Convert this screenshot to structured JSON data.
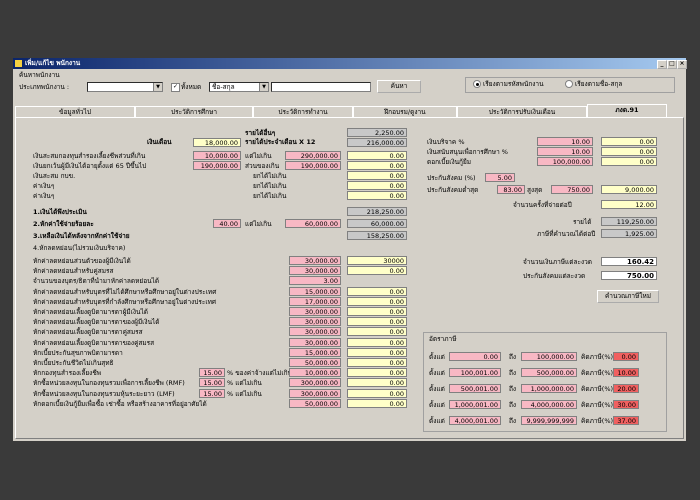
{
  "window": {
    "title": "เพิ่ม/แก้ไข พนักงาน",
    "min": "_",
    "max": "□",
    "close": "×"
  },
  "search": {
    "group_label": "ค้นหาพนักงาน",
    "type_label": "ประเภทพนักงาน :",
    "type_value": "",
    "all_label": "ทั้งหมด",
    "field_value": "ชื่อ-สกุล",
    "text_value": "",
    "search_button": "ค้นหา",
    "radio_by_id": "เรียงตามรหัสพนักงาน",
    "radio_by_name": "เรียงตามชื่อ-สกุล"
  },
  "tabs": [
    "ข้อมูลทั่วไป",
    "ประวัติการศึกษา",
    "ประวัติการทำงาน",
    "ฝึกอบรม/ดูงาน",
    "ประวัติการปรับเงินเดือน",
    "ภงด.91"
  ],
  "left": {
    "salary_label": "เงินเดือน",
    "salary": "18,000.00",
    "income_label": "รายได้อื่นๆ",
    "income": "2,250.00",
    "annual_label": "รายได้ประจำเดือน X 12",
    "annual": "216,000.00",
    "r1": "เงินสะสมกองทุนสำรองเลี้ยงชีพส่วนที่เกิน",
    "r1v": "10,000.00",
    "r1n": "แต่ไม่เกิน",
    "r1m": "290,000.00",
    "r1x": "0.00",
    "r2": "เงินยกเว้นผู้มีเงินได้อายุตั้งแต่ 65 ปีขึ้นไป",
    "r2v": "190,000.00",
    "r2n": "ส่วนของเกิน",
    "r2m": "190,000.00",
    "r2x": "0.00",
    "r3": "เงินสะสม กบข.",
    "r3n": "ยกได้ไม่เกิน",
    "r3x": "0.00",
    "r4": "ค่าเงินๆ",
    "r4n": "ยกได้ไม่เกิน",
    "r4x": "0.00",
    "r5": "ค่าเงินๆ",
    "r5n": "ยกได้ไม่เกิน",
    "r5x": "0.00",
    "s1": "1.เงินได้พึงประเมิน",
    "s1x": "218,250.00",
    "s2": "2.หักค่าใช้จ่ายร้อยละ",
    "s2v": "40.00",
    "s2n": "แต่ไม่เกิน",
    "s2m": "60,000.00",
    "s2x": "60,000.00",
    "s3": "3.เหลือเงินได้หลังจากหักค่าใช้จ่าย",
    "s3x": "158,250.00",
    "s4": "4.หักลดหย่อน(ไม่รวมเงินบริจาค)"
  },
  "deductions": [
    {
      "label": "หักค่าลดหย่อนส่วนตัวของผู้มีเงินได้",
      "max": "30,000.00",
      "val": "30000"
    },
    {
      "label": "หักค่าลดหย่อนสำหรับคู่สมรส",
      "max": "30,000.00",
      "val": "0.00"
    },
    {
      "label": "จำนวนของบุตร/ธิดาที่นำมาหักค่าลดหย่อนได้",
      "max": "3.00",
      "val": ""
    },
    {
      "label": "หักค่าลดหย่อนสำหรับบุตรที่ไม่ได้ศึกษาหรือศึกษาอยู่ในต่างประเทศ",
      "max": "15,000.00",
      "val": "0.00"
    },
    {
      "label": "หักค่าลดหย่อนสำหรับบุตรที่กำลังศึกษาหรือศึกษาอยู่ในต่างประเทศ",
      "max": "17,000.00",
      "val": "0.00"
    },
    {
      "label": "หักค่าลดหย่อนเลี้ยงดูบิดามารดาผู้มีเงินได้",
      "max": "30,000.00",
      "val": "0.00"
    },
    {
      "label": "หักค่าลดหย่อนเลี้ยงดูบิดามารดาของผู้มีเงินได้",
      "max": "30,000.00",
      "val": "0.00"
    },
    {
      "label": "หักค่าลดหย่อนเลี้ยงดูบิดามารดาคู่สมรส",
      "max": "30,000.00",
      "val": "0.00"
    },
    {
      "label": "หักค่าลดหย่อนเลี้ยงดูบิดามารดาของคู่สมรส",
      "max": "30,000.00",
      "val": "0.00"
    },
    {
      "label": "หักเบี้ยประกันสุขภาพบิดามารดา",
      "max": "15,000.00",
      "val": "0.00"
    },
    {
      "label": "หักเบี้ยประกันชีวิตไม่เกินสุทธิ",
      "max": "50,000.00",
      "val": "0.00"
    },
    {
      "label": "หักกองทุนสำรองเลี้ยงชีพ",
      "pct": "15.00",
      "note": "% ของค่าจ้างแต่ไม่เกิน",
      "max": "10,000.00",
      "val": "0.00"
    },
    {
      "label": "หักซื้อหน่วยลงทุนในกองทุนรวมเพื่อการเลี้ยงชีพ (RMF)",
      "pct": "15.00",
      "note": "% แต่ไม่เกิน",
      "max": "300,000.00",
      "val": "0.00"
    },
    {
      "label": "หักซื้อหน่วยลงทุนในกองทุนรวมหุ้นระยะยาว (LMF)",
      "pct": "15.00",
      "note": "% แต่ไม่เกิน",
      "max": "300,000.00",
      "val": "0.00"
    },
    {
      "label": "หักดอกเบี้ยเงินกู้ยืมเพื่อซื้อ เช่าซื้อ หรือสร้างอาคารที่อยู่อาศัยได้",
      "max": "50,000.00",
      "val": "0.00"
    }
  ],
  "right": {
    "d1": "เงินบริจาค %",
    "d1v": "10.00",
    "d1x": "0.00",
    "d2": "เงินสนับสนุนเพื่อการศึกษา %",
    "d2v": "10.00",
    "d2x": "0.00",
    "d3": "ดอกเบี้ยเงินกู้ยืม",
    "d3v": "100,000.00",
    "d3x": "0.00",
    "d4": "ประกันสังคม (%)",
    "d4v": "5.00",
    "d5": "ประกันสังคมต่ำสุด",
    "d5v": "83.00",
    "d5n": "สูงสุด",
    "d5m": "750.00",
    "d5x": "9,000.00",
    "d6": "จำนวนครั้งที่จ่ายต่อปี",
    "d6x": "12.00",
    "d7": "รายได้",
    "d7x": "119,250.00",
    "d8": "ภาษีที่คำนวณได้ต่อปี",
    "d8x": "1,925.00",
    "d9": "จำนวนเงินภาษีแต่ละงวด",
    "d9x": "160.42",
    "d10": "ประกันสังคมแต่ละงวด",
    "d10x": "750.00",
    "calc_button": "คำนวณภาษีใหม่"
  },
  "tax_rates": {
    "title": "อัตราภาษี",
    "from_label": "ตั้งแต่",
    "to_label": "ถึง",
    "rate_label": "คิดภาษี(%)",
    "rows": [
      {
        "from": "0.00",
        "to": "100,000.00",
        "rate": "0.00"
      },
      {
        "from": "100,001.00",
        "to": "500,000.00",
        "rate": "10.00"
      },
      {
        "from": "500,001.00",
        "to": "1,000,000.00",
        "rate": "20.00"
      },
      {
        "from": "1,000,001.00",
        "to": "4,000,000.00",
        "rate": "30.00"
      },
      {
        "from": "4,000,001.00",
        "to": "9,999,999,999",
        "rate": "37.00"
      }
    ]
  }
}
